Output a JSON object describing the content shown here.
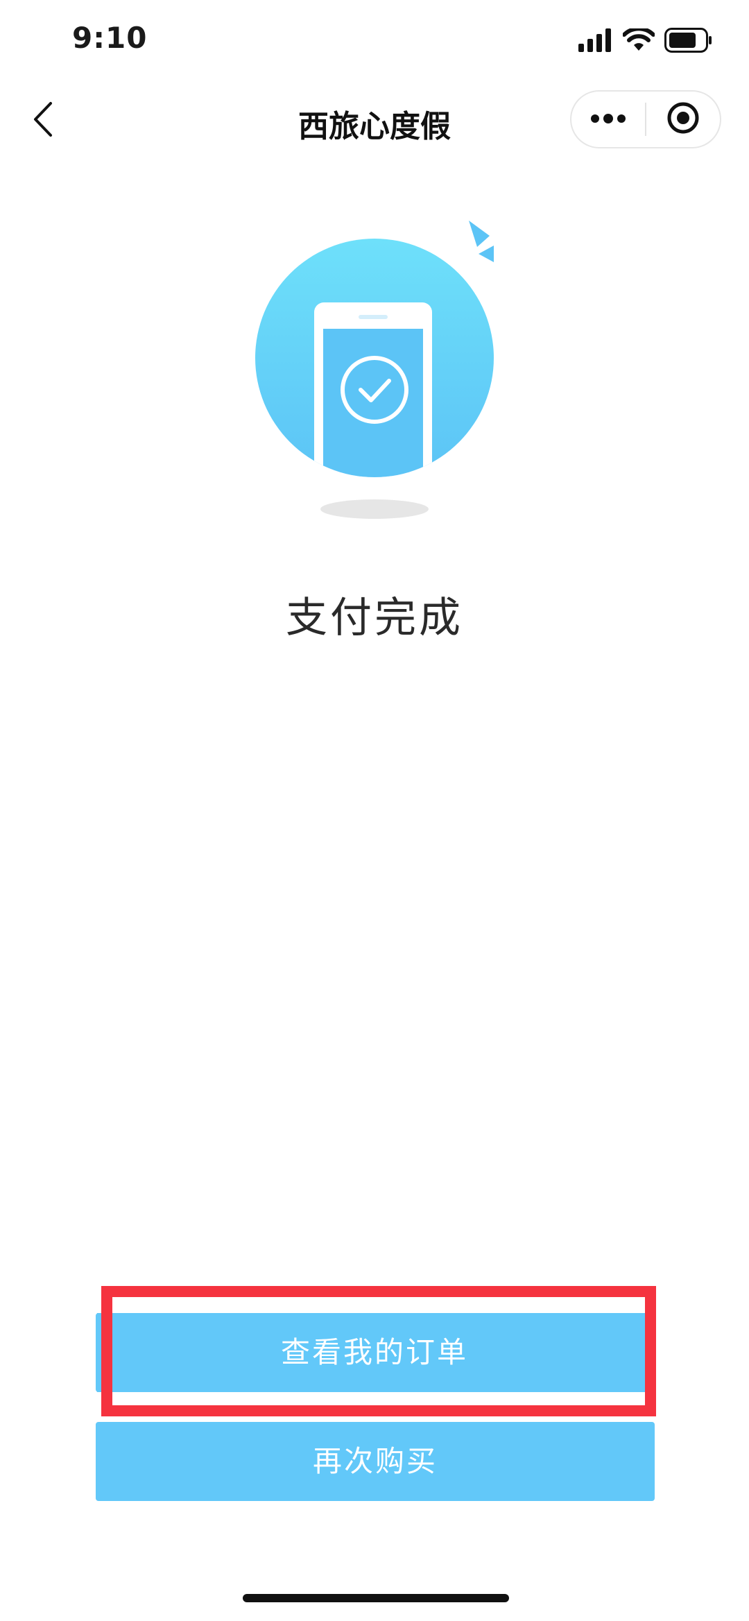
{
  "status_bar": {
    "time": "9:10"
  },
  "nav": {
    "title": "西旅心度假"
  },
  "result": {
    "message": "支付完成"
  },
  "actions": {
    "view_orders": "查看我的订单",
    "buy_again": "再次购买"
  },
  "colors": {
    "accent": "#62c8f9",
    "highlight": "#f5333f",
    "circle_top": "#6ee0fa",
    "circle_bottom": "#5cc4f6"
  },
  "icons": {
    "back": "back-chevron-icon",
    "more": "more-dots-icon",
    "close_miniprogram": "target-circle-icon",
    "success": "phone-check-illustration"
  }
}
